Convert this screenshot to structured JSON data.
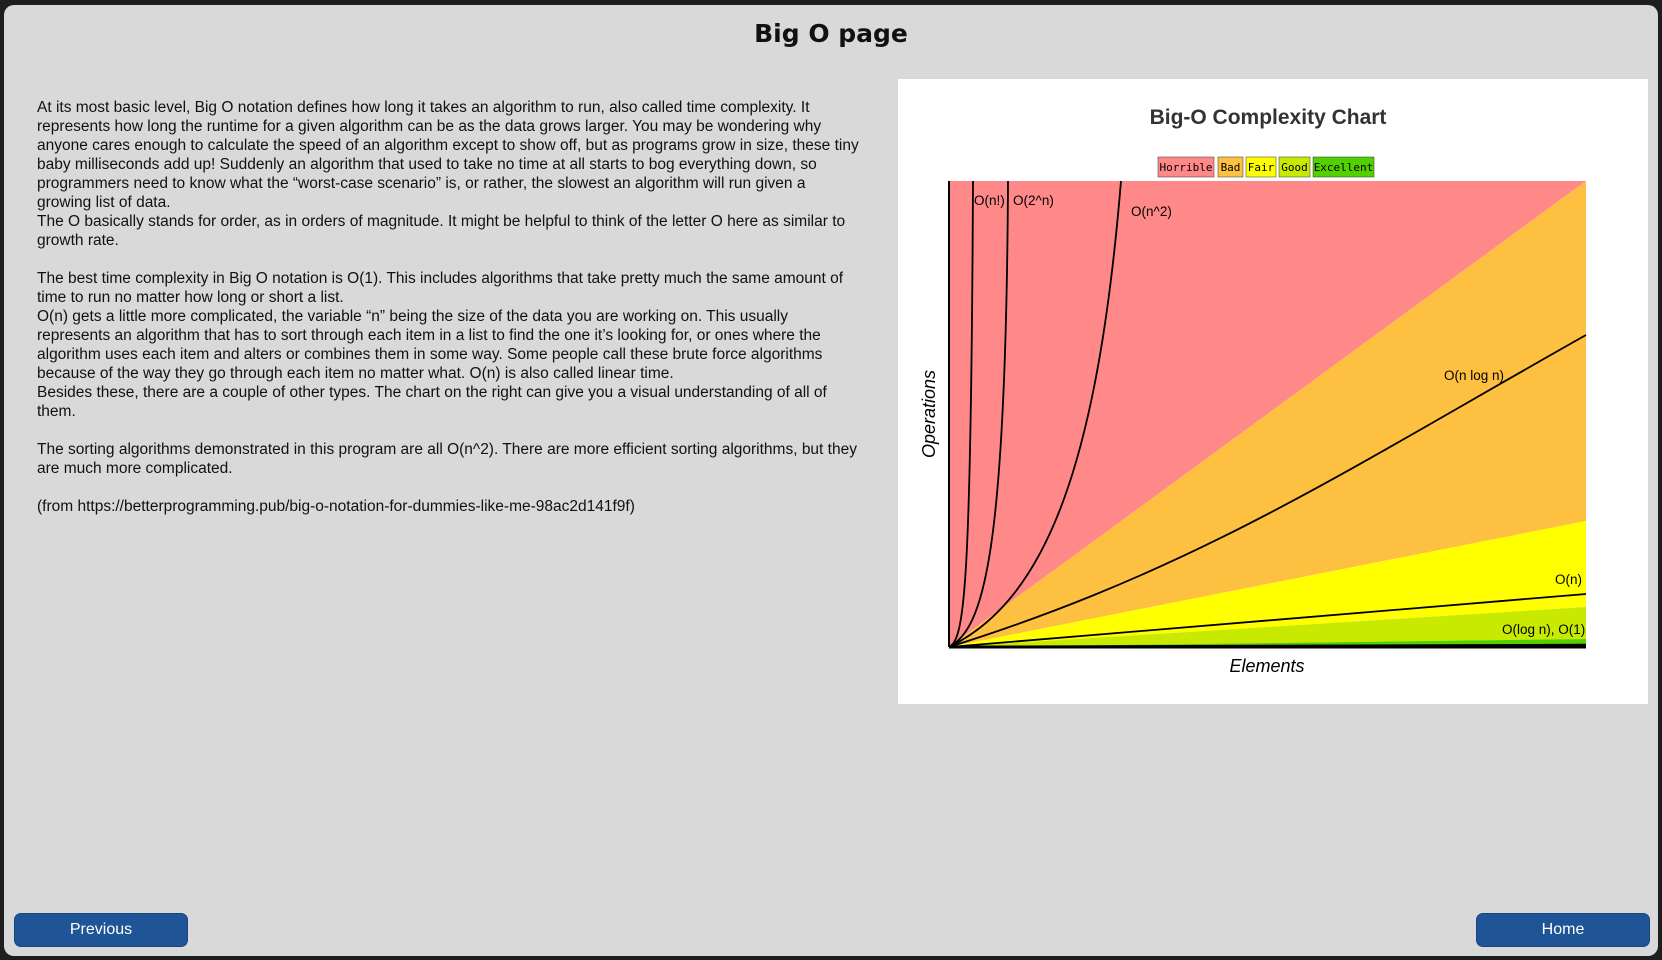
{
  "page": {
    "title": "Big O page"
  },
  "content": {
    "paragraphs": [
      "At its most basic level, Big O notation defines how long it takes an algorithm to run, also called time complexity. It represents how long the runtime for a given algorithm can be as the data grows larger. You may be wondering why anyone cares enough to calculate the speed of an algorithm except to show off, but as programs grow in size, these tiny baby milliseconds add up! Suddenly an algorithm that used to take no time at all starts to bog everything down, so programmers need to know what the “worst-case scenario” is, or rather, the slowest an algorithm will run given a growing list of data.",
      "The O basically stands for order, as in orders of magnitude. It might be helpful to think of the letter O here as similar to growth rate.",
      "The best time complexity in Big O notation is O(1). This includes algorithms that take pretty much the same amount of time to run no matter how long or short a list.",
      "O(n) gets a little more complicated, the variable “n” being the size of the data you are working on. This usually represents an algorithm that has to sort through each item in a list to find the one it’s looking for, or ones where the algorithm uses each item and alters or combines them in some way. Some people call these brute force algorithms because of the way they go through each item no matter what. O(n) is also called linear time.",
      "Besides these, there are a couple of other types. The chart on the right can give you a visual understanding of all of them.",
      "The sorting algorithms demonstrated in this program are all O(n^2). There are more efficient sorting algorithms, but they are much more complicated.",
      "(from https://betterprogramming.pub/big-o-notation-for-dummies-like-me-98ac2d141f9f)"
    ]
  },
  "chart": {
    "title": "Big-O Complexity Chart",
    "xlabel": "Elements",
    "ylabel": "Operations",
    "legend": [
      {
        "label": "Horrible",
        "color": "#ff8989"
      },
      {
        "label": "Bad",
        "color": "#fec041"
      },
      {
        "label": "Fair",
        "color": "#ffff00"
      },
      {
        "label": "Good",
        "color": "#c8ea00"
      },
      {
        "label": "Excellent",
        "color": "#53d000"
      }
    ],
    "curve_labels": {
      "factorial": "O(n!)",
      "exponential": "O(2^n)",
      "quadratic": "O(n^2)",
      "nlogn": "O(n log n)",
      "linear": "O(n)",
      "log_const": "O(log n), O(1)"
    }
  },
  "chart_data": {
    "type": "area",
    "title": "Big-O Complexity Chart",
    "xlabel": "Elements",
    "ylabel": "Operations",
    "legend_position": "top",
    "series": [
      {
        "name": "O(n!)",
        "category": "Horrible"
      },
      {
        "name": "O(2^n)",
        "category": "Horrible"
      },
      {
        "name": "O(n^2)",
        "category": "Horrible"
      },
      {
        "name": "O(n log n)",
        "category": "Bad"
      },
      {
        "name": "O(n)",
        "category": "Fair"
      },
      {
        "name": "O(log n), O(1)",
        "category": "Good / Excellent"
      }
    ]
  },
  "buttons": {
    "previous": "Previous",
    "home": "Home"
  },
  "colors": {
    "background": "#d9d9d9",
    "button": "#1f5596",
    "button_text": "#ffffff"
  }
}
